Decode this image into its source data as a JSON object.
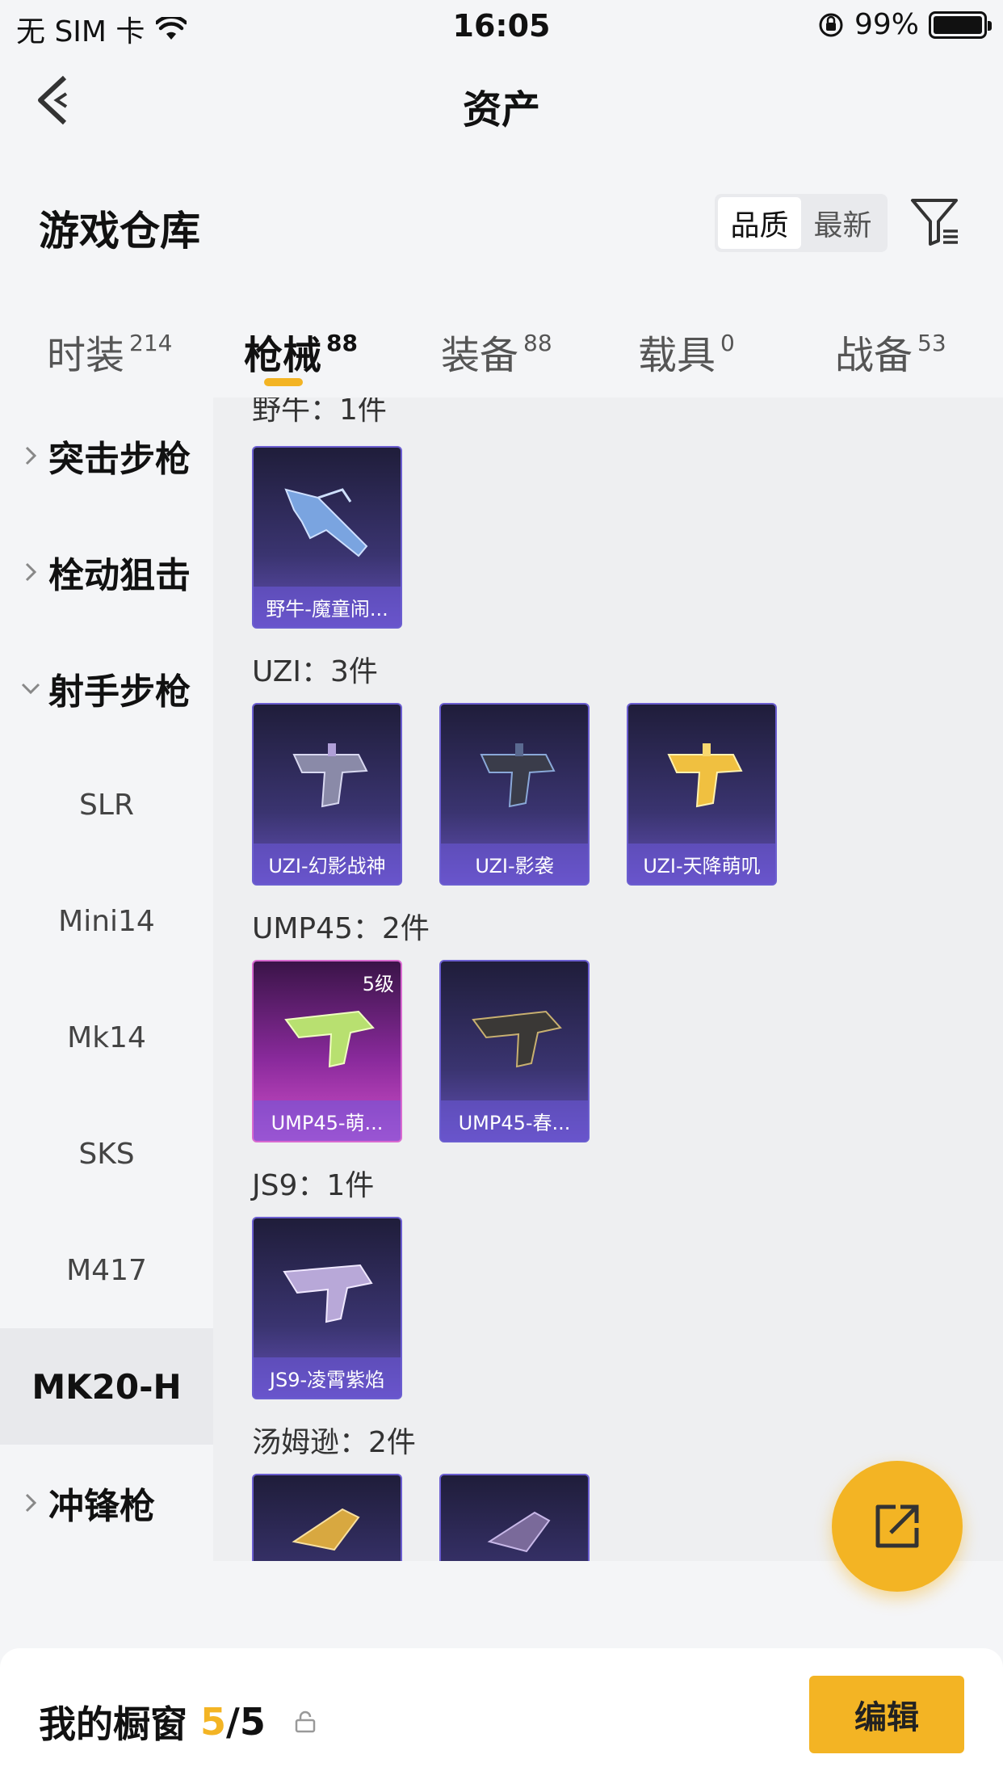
{
  "status_bar": {
    "carrier": "无 SIM 卡",
    "time": "16:05",
    "battery": "99%"
  },
  "nav": {
    "title": "资产"
  },
  "warehouse": {
    "title": "游戏仓库",
    "sort_options": [
      "品质",
      "最新"
    ],
    "sort_selected": "品质"
  },
  "tabs": [
    {
      "label": "时装",
      "count": "214"
    },
    {
      "label": "枪械",
      "count": "88",
      "active": true
    },
    {
      "label": "装备",
      "count": "88"
    },
    {
      "label": "载具",
      "count": "0"
    },
    {
      "label": "战备",
      "count": "53"
    }
  ],
  "sidebar": {
    "categories": [
      {
        "label": "突击步枪",
        "expanded": false
      },
      {
        "label": "栓动狙击",
        "expanded": false
      },
      {
        "label": "射手步枪",
        "expanded": true
      },
      {
        "label": "冲锋枪",
        "expanded": false
      }
    ],
    "subitems": [
      "SLR",
      "Mini14",
      "Mk14",
      "SKS",
      "M417",
      "MK20-H"
    ],
    "selected_subitem": "MK20-H"
  },
  "groups": [
    {
      "title": "野牛：1件",
      "items": [
        {
          "name": "野牛-魔童闹...",
          "style": "purple"
        }
      ]
    },
    {
      "title": "UZI：3件",
      "items": [
        {
          "name": "UZI-幻影战神",
          "style": "purple"
        },
        {
          "name": "UZI-影袭",
          "style": "purple"
        },
        {
          "name": "UZI-天降萌叽",
          "style": "purple"
        }
      ]
    },
    {
      "title": "UMP45：2件",
      "items": [
        {
          "name": "UMP45-萌...",
          "style": "pink",
          "level": "5级"
        },
        {
          "name": "UMP45-春...",
          "style": "purple"
        }
      ]
    },
    {
      "title": "JS9：1件",
      "items": [
        {
          "name": "JS9-凌霄紫焰",
          "style": "purple"
        }
      ]
    },
    {
      "title": "汤姆逊：2件",
      "items": [
        {
          "name": "",
          "style": "purple"
        },
        {
          "name": "",
          "style": "purple"
        }
      ]
    }
  ],
  "showcase": {
    "label": "我的橱窗",
    "count": "5",
    "total": "/5"
  },
  "edit_button": "编辑",
  "colors": {
    "accent": "#f3b424",
    "card_purple": "#3a3470",
    "card_pink": "#8a2a9c"
  }
}
